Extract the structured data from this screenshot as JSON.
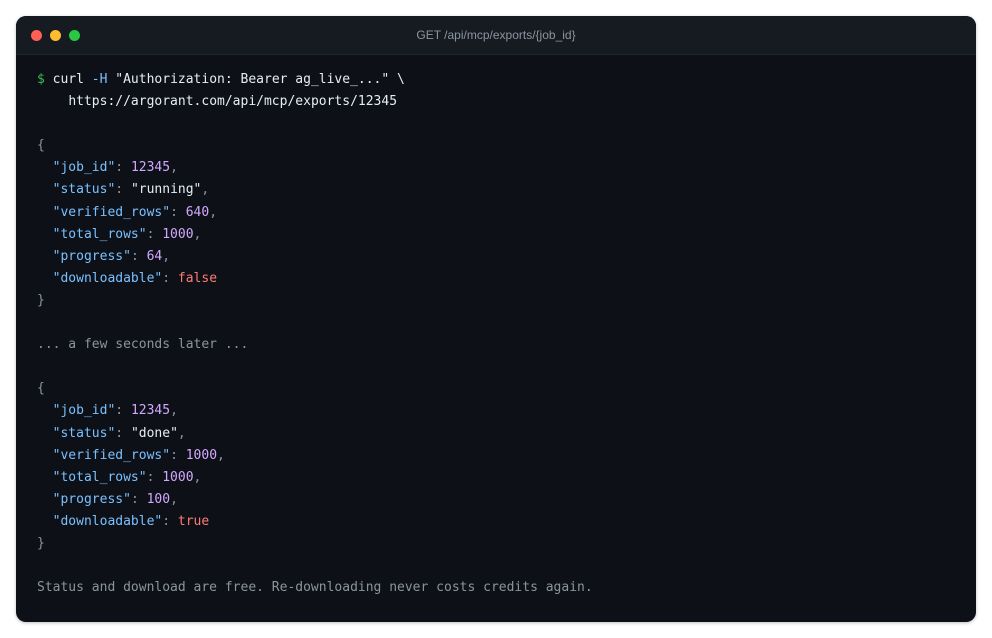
{
  "window": {
    "title": "GET /api/mcp/exports/{job_id}",
    "controls": {
      "close_color": "#ff5f57",
      "minimize_color": "#febc2e",
      "maximize_color": "#28c840"
    }
  },
  "command": {
    "prompt": "$",
    "program": "curl",
    "flag": "-H",
    "header": "\"Authorization: Bearer ag_live_...\"",
    "continuation": "\\",
    "url": "https://argorant.com/api/mcp/exports/12345"
  },
  "responses": [
    {
      "job_id": "12345",
      "status": "\"running\"",
      "verified_rows": "640",
      "total_rows": "1000",
      "progress": "64",
      "downloadable": "false"
    },
    {
      "job_id": "12345",
      "status": "\"done\"",
      "verified_rows": "1000",
      "total_rows": "1000",
      "progress": "100",
      "downloadable": "true"
    }
  ],
  "keys": {
    "job_id": "\"job_id\"",
    "status": "\"status\"",
    "verified_rows": "\"verified_rows\"",
    "total_rows": "\"total_rows\"",
    "progress": "\"progress\"",
    "downloadable": "\"downloadable\""
  },
  "separator": "... a few seconds later ...",
  "footer_note": "Status and download are free. Re-downloading never costs credits again."
}
